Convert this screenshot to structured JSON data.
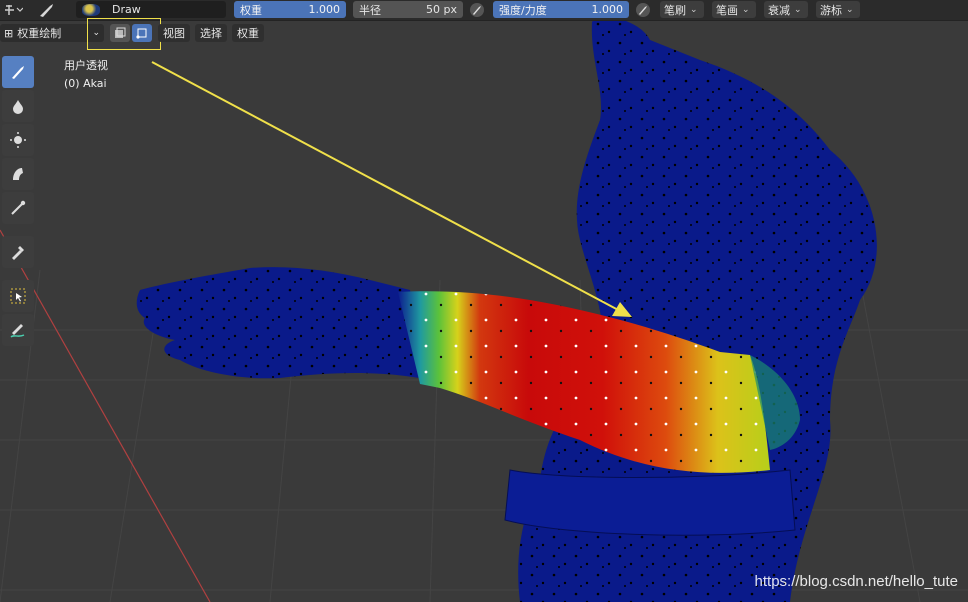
{
  "header": {
    "brush_name": "Draw",
    "weight": {
      "label": "权重",
      "value": "1.000"
    },
    "radius": {
      "label": "半径",
      "value": "50 px"
    },
    "strength": {
      "label": "强度/力度",
      "value": "1.000"
    },
    "menus": [
      "笔刷",
      "笔画",
      "衰减",
      "游标"
    ]
  },
  "subheader": {
    "mode_label": "权重绘制",
    "menus": [
      "视图",
      "选择",
      "权重"
    ]
  },
  "viewport": {
    "view_name": "用户透视",
    "object_name": "(0) Akai"
  },
  "toolbar": {
    "tools": [
      "draw-brush-icon",
      "blur-drop-icon",
      "average-icon",
      "smear-icon",
      "gradient-icon",
      "sample-weight-icon",
      "select-box-icon",
      "annotate-icon"
    ]
  },
  "colors": {
    "accent": "#4b74b8",
    "highlight": "#f0e04a",
    "mesh_blue": "#0a1a8a"
  },
  "watermark": "https://blog.csdn.net/hello_tute"
}
